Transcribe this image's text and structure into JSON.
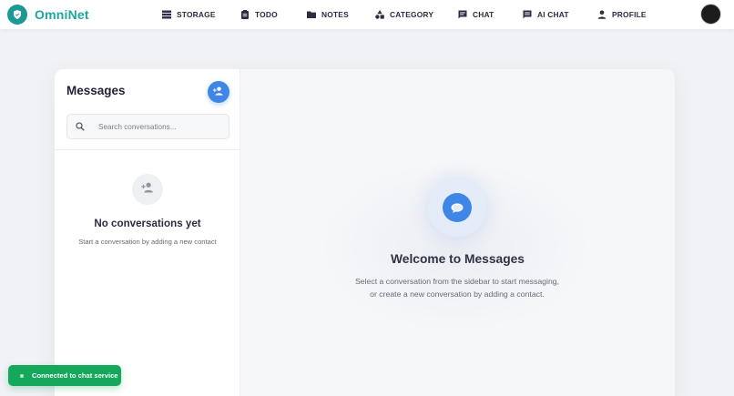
{
  "brand": {
    "name": "OmniNet"
  },
  "nav": {
    "items": [
      {
        "label": "STORAGE",
        "icon": "storage-icon"
      },
      {
        "label": "TODO",
        "icon": "clipboard-icon"
      },
      {
        "label": "NOTES",
        "icon": "folder-icon"
      },
      {
        "label": "CATEGORY",
        "icon": "category-icon"
      },
      {
        "label": "CHAT",
        "icon": "chat-icon"
      },
      {
        "label": "AI CHAT",
        "icon": "ai-chat-icon"
      },
      {
        "label": "PROFILE",
        "icon": "person-icon"
      }
    ]
  },
  "sidebar": {
    "title": "Messages",
    "search_placeholder": "Search conversations...",
    "empty_title": "No conversations yet",
    "empty_subtitle": "Start a conversation by adding a new contact"
  },
  "welcome": {
    "title": "Welcome to Messages",
    "text": "Select a conversation from the sidebar to start messaging, or create a new conversation by adding a contact."
  },
  "toast": {
    "text": "Connected to chat service"
  },
  "colors": {
    "brand": "#1fa69f",
    "accent": "#3f86e6",
    "success": "#16a85a",
    "background": "#f1f2f6"
  }
}
